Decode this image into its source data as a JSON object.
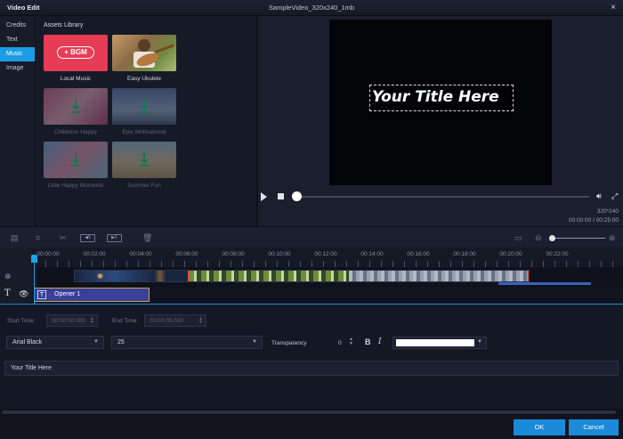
{
  "window": {
    "title": "Video Edit",
    "file_name": "SampleVideo_320x240_1mb",
    "close_glyph": "×"
  },
  "sidebar": {
    "items": [
      {
        "label": "Credits",
        "active": false
      },
      {
        "label": "Text",
        "active": false
      },
      {
        "label": "Music",
        "active": true
      },
      {
        "label": "Image",
        "active": false
      }
    ]
  },
  "assets": {
    "title": "Assets Library",
    "bgm_label": "+ BGM",
    "items": [
      {
        "label": "Local Music",
        "downloaded": true
      },
      {
        "label": "Easy Ukulele",
        "downloaded": true
      },
      {
        "label": "Childrens Happy",
        "downloaded": false
      },
      {
        "label": "Epic Motivational",
        "downloaded": false
      },
      {
        "label": "Little Happy Moments",
        "downloaded": false
      },
      {
        "label": "Summer Fun",
        "downloaded": false
      }
    ]
  },
  "preview": {
    "overlay_text": "Your Title Here",
    "resolution": "320*240",
    "time": "00:00:00 / 00:25:00",
    "progress": 0
  },
  "timeline": {
    "ruler": [
      "00:00:00",
      "00:02:00",
      "00:04:00",
      "00:06:00",
      "00:08:00",
      "00:10:00",
      "00:12:00",
      "00:14:00",
      "00:16:00",
      "00:18:00",
      "00:20:00",
      "00:22:00"
    ],
    "text_clip_label": "Opener 1"
  },
  "properties": {
    "start_time_label": "Start Time:",
    "start_time_value": "00:00:00.000",
    "end_time_label": "End Time:",
    "end_time_value": "00:00:05.000",
    "font": "Arial Black",
    "size": "25",
    "transparency_label": "Transparency",
    "transparency_value": "0",
    "bold": "B",
    "italic": "I",
    "text_color": "#ffffff",
    "text_value": "Your Title Here"
  },
  "footer": {
    "ok": "OK",
    "cancel": "Cancel"
  },
  "colors": {
    "accent": "#1a9de4",
    "button": "#1a8ad9",
    "background": "#141824"
  }
}
